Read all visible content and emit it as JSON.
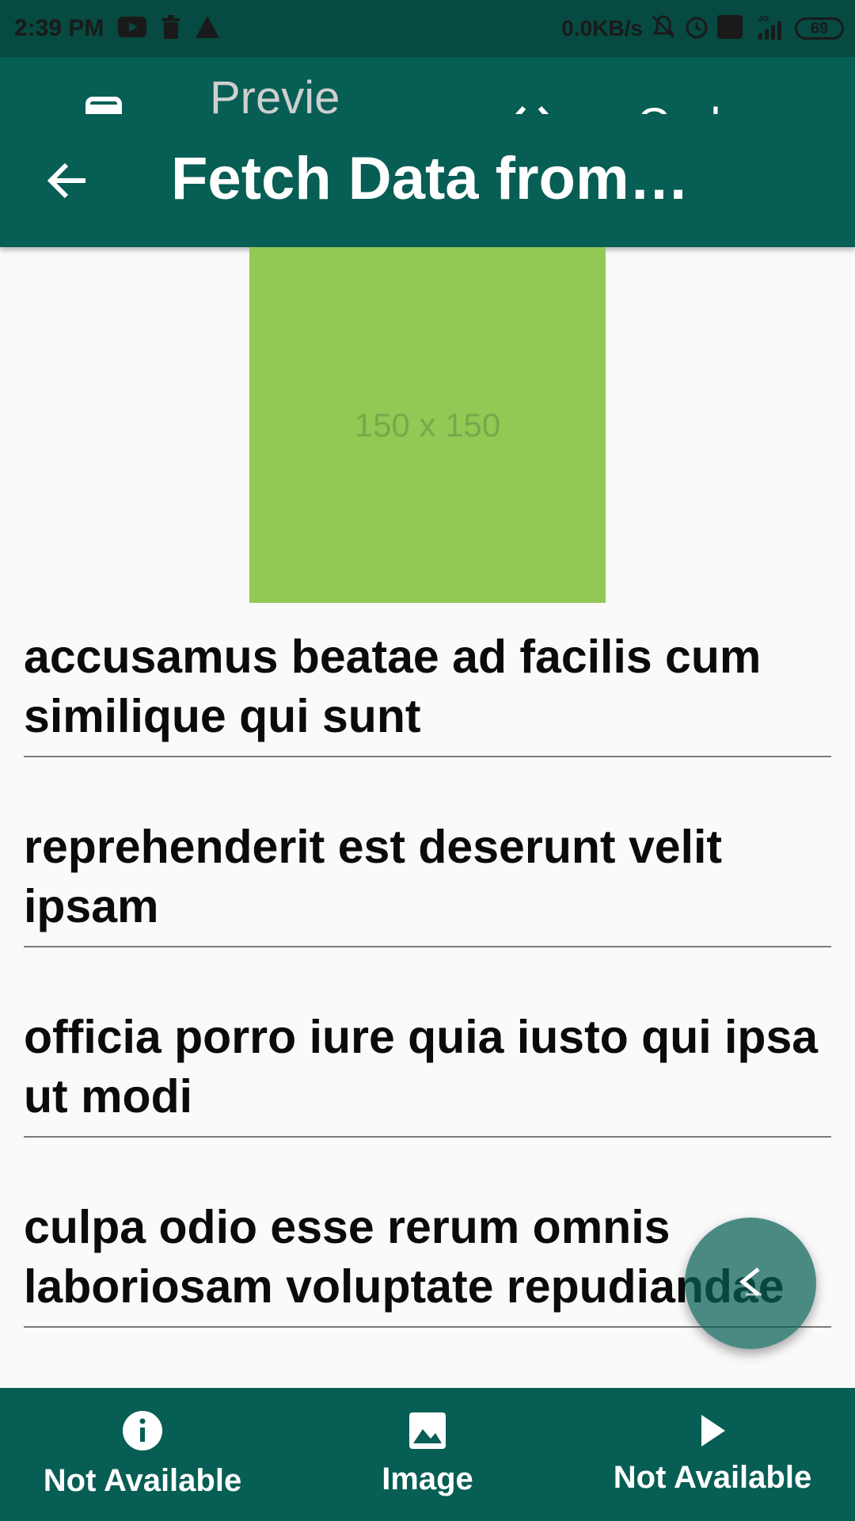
{
  "status_bar": {
    "time": "2:39 PM",
    "net_speed": "0.0KB/s",
    "network": "4G",
    "battery": "69"
  },
  "top_tabs": {
    "preview_label": "Preview",
    "code_label": "Code"
  },
  "app_bar": {
    "title": "Fetch Data from ..."
  },
  "thumbnail": {
    "text": "150 x 150",
    "color": "#92c954"
  },
  "list": {
    "items": [
      "accusamus beatae ad facilis cum similique qui sunt",
      "reprehenderit est deserunt velit ipsam",
      "officia porro iure quia iusto qui ipsa ut modi",
      "culpa odio esse rerum omnis laboriosam voluptate repudiandae"
    ]
  },
  "bottom_nav": {
    "items": [
      {
        "label": "Not Available",
        "icon": "info-icon"
      },
      {
        "label": "Image",
        "icon": "image-icon"
      },
      {
        "label": "Not Available",
        "icon": "play-icon"
      }
    ]
  },
  "colors": {
    "primary": "#075e54",
    "status": "#064a41",
    "placeholder": "#92c954"
  }
}
